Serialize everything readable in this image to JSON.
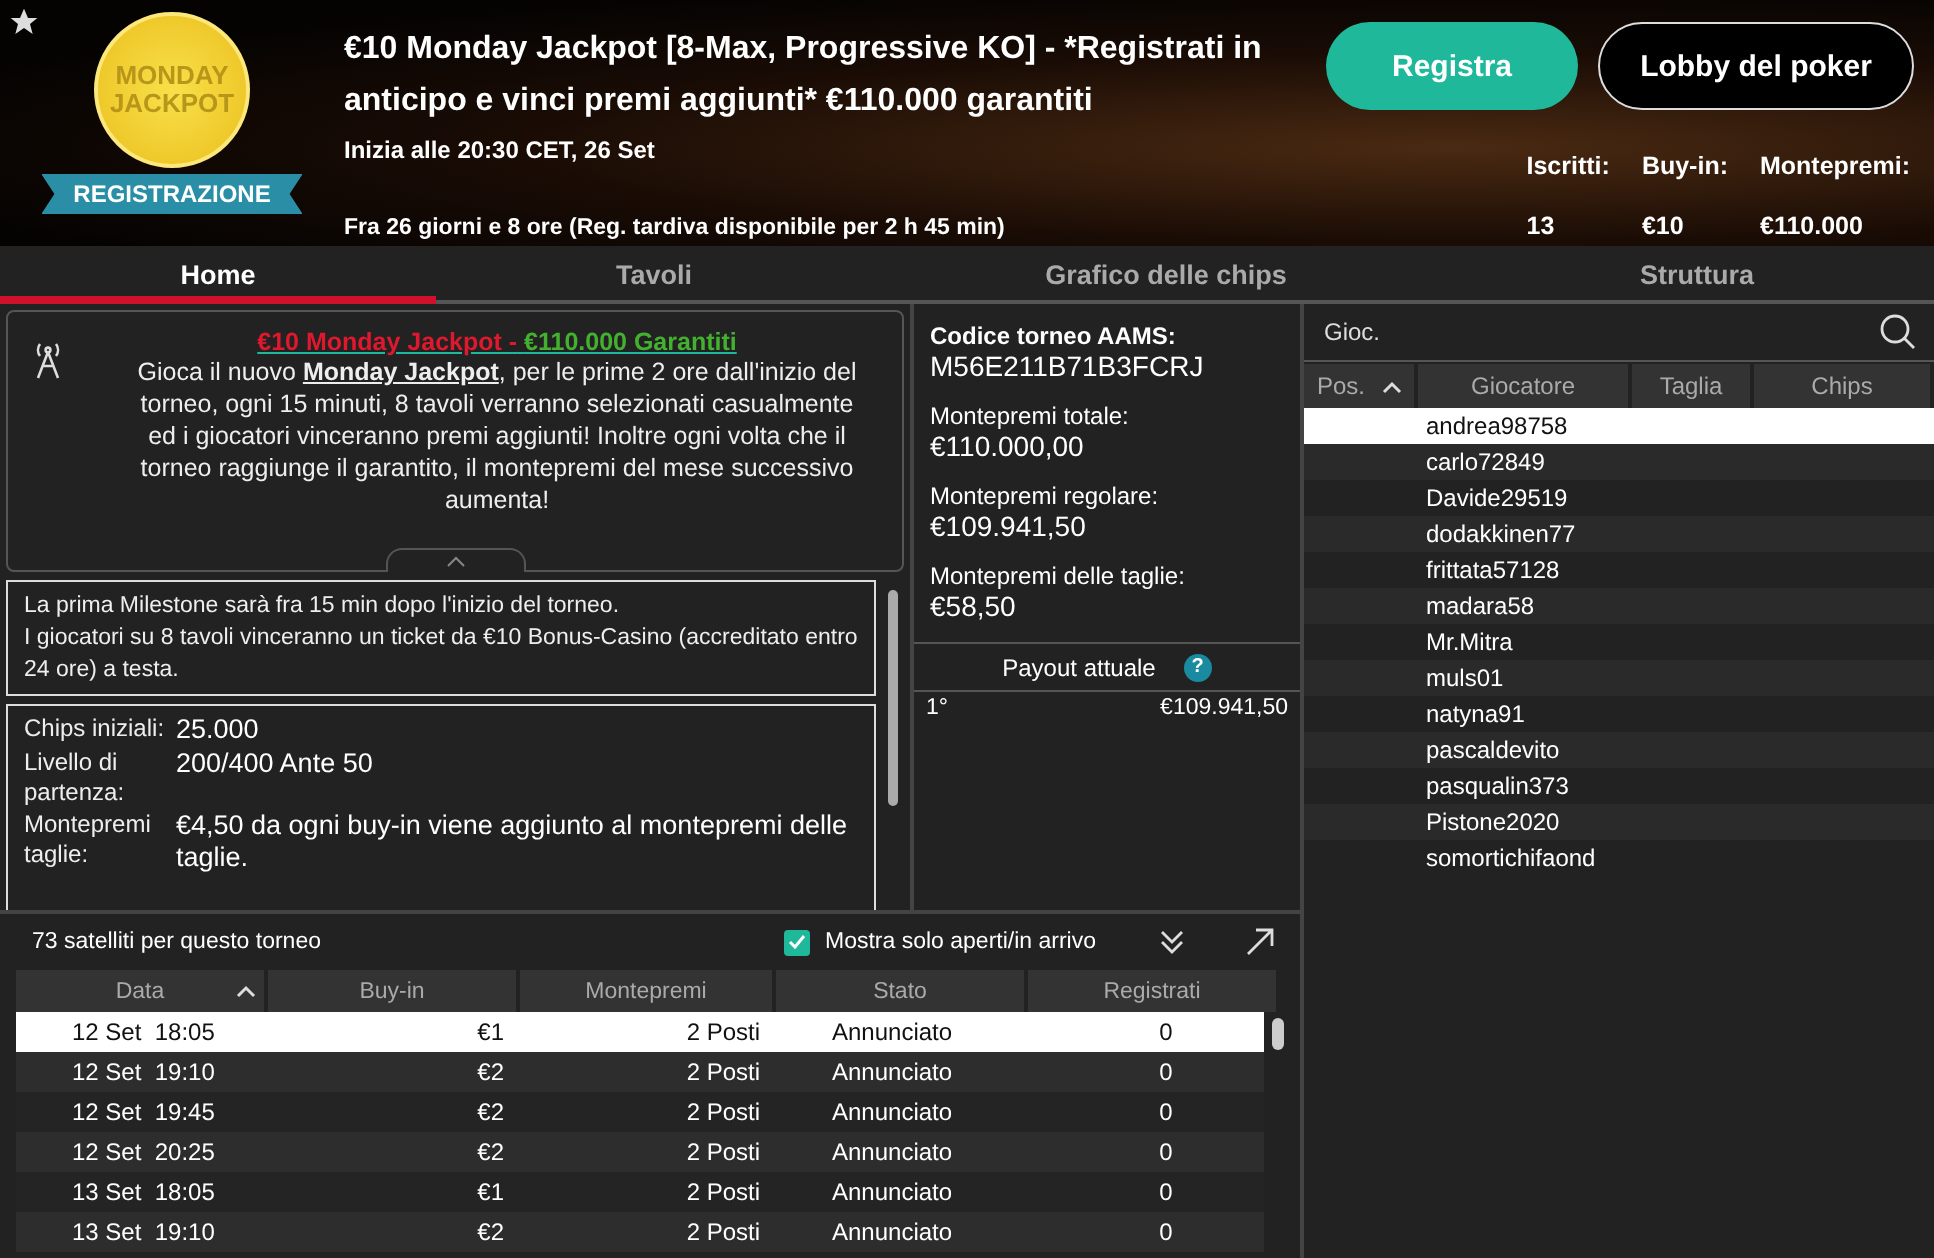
{
  "header": {
    "badge": {
      "line1": "MONDAY",
      "line2": "JACKPOT",
      "ribbon": "REGISTRAZIONE"
    },
    "favorite": true,
    "title": "€10 Monday Jackpot [8-Max, Progressive KO] - *Registrati in anticipo e vinci premi aggiunti* €110.000 garantiti",
    "start": "Inizia alle 20:30 CET, 26 Set",
    "countdown": "Fra 26 giorni e 8 ore (Reg. tardiva disponibile per 2 h 45 min)",
    "buttons": [
      {
        "label": "Registra",
        "kind": "primary"
      },
      {
        "label": "Lobby del poker",
        "kind": "outline"
      }
    ],
    "stats": [
      {
        "label": "Iscritti:",
        "value": "13"
      },
      {
        "label": "Buy-in:",
        "value": "€10"
      },
      {
        "label": "Montepremi:",
        "value": "€110.000"
      }
    ]
  },
  "tabs": [
    {
      "label": "Home",
      "selected": true
    },
    {
      "label": "Tavoli",
      "selected": false
    },
    {
      "label": "Grafico delle chips",
      "selected": false
    },
    {
      "label": "Struttura",
      "selected": false
    }
  ],
  "promo": {
    "title_red": "€10 Monday Jackpot -",
    "title_green": "€110.000 Garantiti",
    "text": "Gioca il nuovo **Monday Jackpot**, per le prime 2 ore dall'inizio del torneo, ogni 15 minuti, 8 tavoli verranno selezionati casualmente ed i giocatori vinceranno premi aggiunti! Inoltre ogni volta che il torneo raggiunge il garantito, il montepremi del mese successivo aumenta!",
    "expanded": true
  },
  "milestone": [
    "La prima Milestone sarà fra 15 min dopo l'inizio del torneo.",
    "I giocatori su 8 tavoli vinceranno un ticket da €10 Bonus-Casino (accreditato entro 24 ore) a testa."
  ],
  "details": [
    {
      "label": "Chips iniziali:",
      "value": "25.000"
    },
    {
      "label": "Livello di partenza:",
      "value": "200/400 Ante 50"
    },
    {
      "label": "Montepremi taglie:",
      "value": "€4,50 da ogni buy-in viene aggiunto al montepremi delle taglie."
    }
  ],
  "info": [
    {
      "label": "Codice torneo AAMS:",
      "value": "M56E211B71B3FCRJ",
      "kind": "code"
    },
    {
      "label": "Montepremi totale:",
      "value": "€110.000,00",
      "kind": "money"
    },
    {
      "label": "Montepremi regolare:",
      "value": "€109.941,50",
      "kind": "money"
    },
    {
      "label": "Montepremi delle taglie:",
      "value": "€58,50",
      "kind": "money"
    }
  ],
  "payout": {
    "title": "Payout attuale",
    "help": "?",
    "rows": [
      {
        "place": "1°",
        "amount": "€109.941,50"
      }
    ]
  },
  "players": {
    "search_placeholder": "Gioc.",
    "columns": [
      "Pos.",
      "Giocatore",
      "Taglia",
      "Chips"
    ],
    "rows": [
      {
        "name": "andrea98758",
        "selected": true
      },
      {
        "name": "carlo72849",
        "selected": false
      },
      {
        "name": "Davide29519",
        "selected": false
      },
      {
        "name": "dodakkinen77",
        "selected": false
      },
      {
        "name": "frittata57128",
        "selected": false
      },
      {
        "name": "madara58",
        "selected": false
      },
      {
        "name": "Mr.Mitra",
        "selected": false
      },
      {
        "name": "muls01",
        "selected": false
      },
      {
        "name": "natyna91",
        "selected": false
      },
      {
        "name": "pascaldevito",
        "selected": false
      },
      {
        "name": "pasqualin373",
        "selected": false
      },
      {
        "name": "Pistone2020",
        "selected": false
      },
      {
        "name": "somortichifaond",
        "selected": false
      }
    ]
  },
  "satellites": {
    "title": "73 satelliti per questo torneo",
    "filter": {
      "label": "Mostra solo aperti/in arrivo",
      "checked": true
    },
    "columns": [
      "Data",
      "Buy-in",
      "Montepremi",
      "Stato",
      "Registrati"
    ],
    "rows": [
      {
        "date": "12 Set  18:05",
        "buyin": "€1",
        "prize": "2 Posti",
        "status": "Annunciato",
        "registered": "0",
        "selected": true
      },
      {
        "date": "12 Set  19:10",
        "buyin": "€2",
        "prize": "2 Posti",
        "status": "Annunciato",
        "registered": "0",
        "selected": false
      },
      {
        "date": "12 Set  19:45",
        "buyin": "€2",
        "prize": "2 Posti",
        "status": "Annunciato",
        "registered": "0",
        "selected": false
      },
      {
        "date": "12 Set  20:25",
        "buyin": "€2",
        "prize": "2 Posti",
        "status": "Annunciato",
        "registered": "0",
        "selected": false
      },
      {
        "date": "13 Set  18:05",
        "buyin": "€1",
        "prize": "2 Posti",
        "status": "Annunciato",
        "registered": "0",
        "selected": false
      },
      {
        "date": "13 Set  19:10",
        "buyin": "€2",
        "prize": "2 Posti",
        "status": "Annunciato",
        "registered": "0",
        "selected": false
      }
    ]
  }
}
